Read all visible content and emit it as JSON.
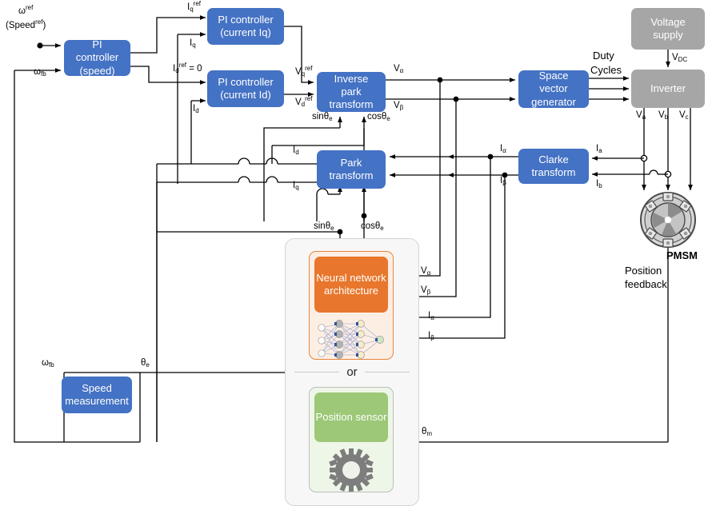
{
  "diagram": {
    "title": "PMSM field-oriented control block diagram",
    "colors": {
      "block_blue": "#4472c4",
      "block_gray": "#a6a6a6",
      "nn_orange": "#e8762c",
      "nn_panel": "#fdeee4",
      "sensor_green": "#9cc878",
      "sensor_panel": "#eef6e8",
      "wire": "#000000",
      "panel_bg": "#f7f7f7"
    }
  },
  "blocks": {
    "pi_speed": {
      "line1": "PI controller",
      "line2": "(speed)"
    },
    "pi_iq": {
      "line1": "PI controller",
      "line2": "(current Iq)"
    },
    "pi_id": {
      "line1": "PI controller",
      "line2": "(current Id)"
    },
    "inverse_park": {
      "line1": "Inverse park",
      "line2": "transform"
    },
    "park": {
      "line1": "Park",
      "line2": "transform"
    },
    "clarke": {
      "line1": "Clarke",
      "line2": "transform"
    },
    "space_vector": {
      "line1": "Space vector",
      "line2": "generator"
    },
    "voltage_supply": {
      "line1": "Voltage",
      "line2": "supply"
    },
    "inverter": {
      "line1": "Inverter"
    },
    "speed_measurement": {
      "line1": "Speed",
      "line2": "measurement"
    },
    "neural_network": {
      "line1": "Neural",
      "line2": "network",
      "line3": "architecture"
    },
    "position_sensor": {
      "line1": "Position",
      "line2": "sensor"
    }
  },
  "signals": {
    "omega_ref": "ω",
    "omega_ref_sup": "ref",
    "speed_ref": "(Speed",
    "speed_ref_sup": "ref",
    "speed_ref_close": ")",
    "omega_fb_top": "ω",
    "omega_fb_sub": "fb",
    "iq_ref": "I",
    "iq_ref_sub": "q",
    "iq_ref_sup": "ref",
    "iq": "I",
    "iq_sub": "q",
    "id_ref_eq": "I",
    "id_ref_sub": "d",
    "id_ref_sup": "ref",
    "id_ref_tail": " = 0",
    "id": "I",
    "id_sub": "d",
    "vq_ref": "V",
    "vq_ref_sub": "q",
    "vq_ref_sup": "ref",
    "vd_ref": "V",
    "vd_ref_sub": "d",
    "vd_ref_sup": "ref",
    "v_alpha": "V",
    "v_alpha_sub": "α",
    "v_beta": "V",
    "v_beta_sub": "β",
    "i_alpha": "I",
    "i_alpha_sub": "α",
    "i_beta": "I",
    "i_beta_sub": "β",
    "i_a": "I",
    "i_a_sub": "a",
    "i_b": "I",
    "i_b_sub": "b",
    "sin_theta_e": "sinθ",
    "cos_theta_e": "cosθ",
    "theta_e_sub": "e",
    "duty": "Duty",
    "cycles": "Cycles",
    "v_dc": "V",
    "v_dc_sub": "DC",
    "v_a": "V",
    "v_a_sub": "a",
    "v_b": "V",
    "v_b_sub": "b",
    "v_c": "V",
    "v_c_sub": "c",
    "pmsm": "PMSM",
    "position_feedback_1": "Position",
    "position_feedback_2": "feedback",
    "theta_e_out": "θ",
    "theta_e_out_sub": "e",
    "theta_m": "θ",
    "theta_m_sub": "m",
    "omega_fb_bottom": "ω",
    "omega_fb_bottom_sub": "fb",
    "or_separator": "or"
  }
}
